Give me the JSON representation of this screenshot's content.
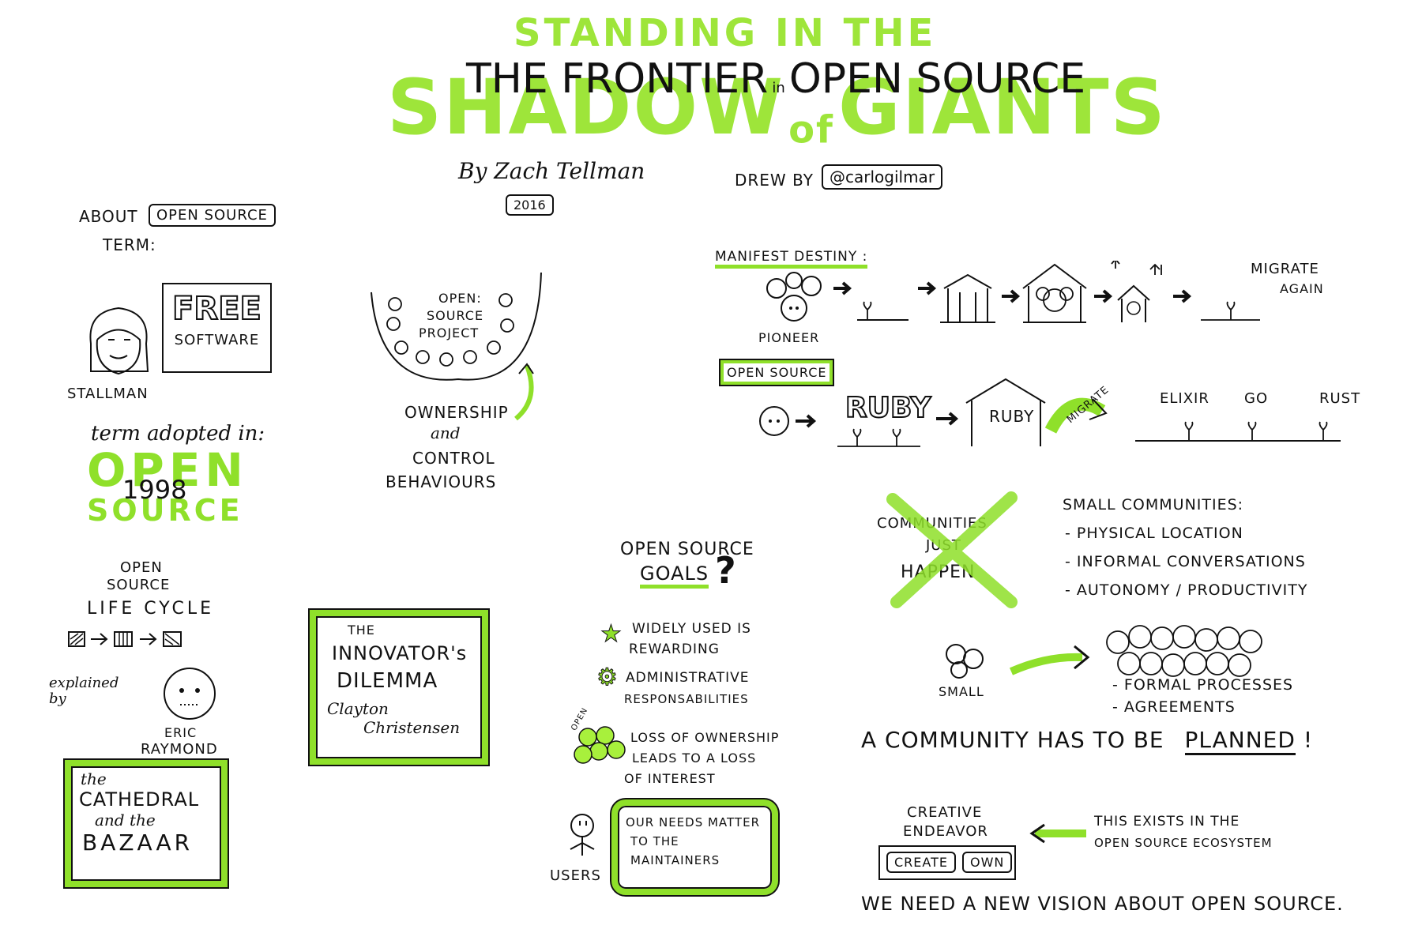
{
  "header": {
    "title_top": "STANDING IN THE",
    "title_main": "SHADOW",
    "title_of": "of",
    "title_giants": "GIANTS",
    "subtitle_left": "THE FRONTIER",
    "subtitle_in": "in",
    "subtitle_right": "OPEN SOURCE",
    "author": "By Zach Tellman",
    "year": "2016",
    "drew_by": "DREW BY",
    "handle": "@carlogilmar"
  },
  "about": {
    "label": "ABOUT",
    "boxed": "OPEN SOURCE",
    "term": "TERM:",
    "person": "STALLMAN",
    "free": "FREE",
    "software": "SOFTWARE",
    "adopted": "term adopted in:",
    "open": "OPEN",
    "source": "SOURCE",
    "year": "1998"
  },
  "lifecycle": {
    "line1": "OPEN",
    "line2": "SOURCE",
    "line3": "LIFE CYCLE",
    "explained": "explained by",
    "person1": "ERIC",
    "person2": "RAYMOND",
    "book_the": "the",
    "book_cathedral": "CATHEDRAL",
    "book_and": "and the",
    "book_bazaar": "BAZAAR"
  },
  "project": {
    "label1": "OPEN:",
    "label2": "SOURCE",
    "label3": "PROJECT",
    "own1": "OWNERSHIP",
    "own2": "and",
    "own3": "CONTROL",
    "own4": "BEHAVIOURS"
  },
  "innovator": {
    "the": "THE",
    "line1": "INNOVATOR's",
    "line2": "DILEMMA",
    "author1": "Clayton",
    "author2": "Christensen"
  },
  "manifest": {
    "label": "MANIFEST DESTINY :",
    "pioneer": "PIONEER",
    "migrate1": "MIGRATE",
    "migrate2": "AGAIN",
    "open_source": "OPEN SOURCE",
    "ruby": "RUBY",
    "ruby_house": "RUBY",
    "migrate_arrow": "MIGRATE",
    "lang1": "ELIXIR",
    "lang2": "GO",
    "lang3": "RUST"
  },
  "goals": {
    "title1": "OPEN SOURCE",
    "title2": "GOALS",
    "q": "?",
    "g1a": "WIDELY USED IS",
    "g1b": "REWARDING",
    "g2a": "ADMINISTRATIVE",
    "g2b": "RESPONSABILITIES",
    "g3a": "LOSS OF OWNERSHIP",
    "g3b": "LEADS TO A LOSS",
    "g3c": "OF INTEREST",
    "open_tag": "OPEN",
    "users": "USERS",
    "needs1": "OUR NEEDS MATTER",
    "needs2": "TO THE",
    "needs3": "MAINTAINERS"
  },
  "community": {
    "cross1": "COMMUNITIES",
    "cross2": "JUST",
    "cross3": "HAPPEN",
    "small_title": "SMALL COMMUNITIES:",
    "s1": "- PHYSICAL LOCATION",
    "s2": "- INFORMAL CONVERSATIONS",
    "s3": "- AUTONOMY / PRODUCTIVITY",
    "small": "SMALL",
    "f1": "- FORMAL PROCESSES",
    "f2": "- AGREEMENTS",
    "planned_pre": "A COMMUNITY HAS TO BE",
    "planned": "PLANNED",
    "bang": "!",
    "creative1": "CREATIVE",
    "creative2": "ENDEAVOR",
    "create": "CREATE",
    "own": "OWN",
    "exists1": "THIS EXISTS IN THE",
    "exists2": "OPEN SOURCE ECOSYSTEM",
    "vision": "WE NEED A NEW VISION ABOUT OPEN SOURCE."
  },
  "colors": {
    "accent": "#9ee53a",
    "ink": "#111111"
  }
}
